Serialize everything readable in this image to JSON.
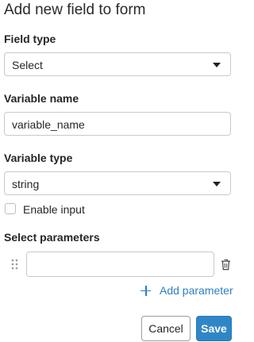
{
  "title": "Add new field to form",
  "field_type": {
    "label": "Field type",
    "value": "Select"
  },
  "variable_name": {
    "label": "Variable name",
    "value": "variable_name"
  },
  "variable_type": {
    "label": "Variable type",
    "value": "string"
  },
  "enable_input": {
    "label": "Enable input",
    "checked": false
  },
  "select_parameters": {
    "label": "Select parameters",
    "params": [
      ""
    ],
    "add_label": "Add parameter"
  },
  "actions": {
    "cancel": "Cancel",
    "save": "Save"
  },
  "colors": {
    "accent": "#2f86c6",
    "link": "#2f7fc1"
  }
}
